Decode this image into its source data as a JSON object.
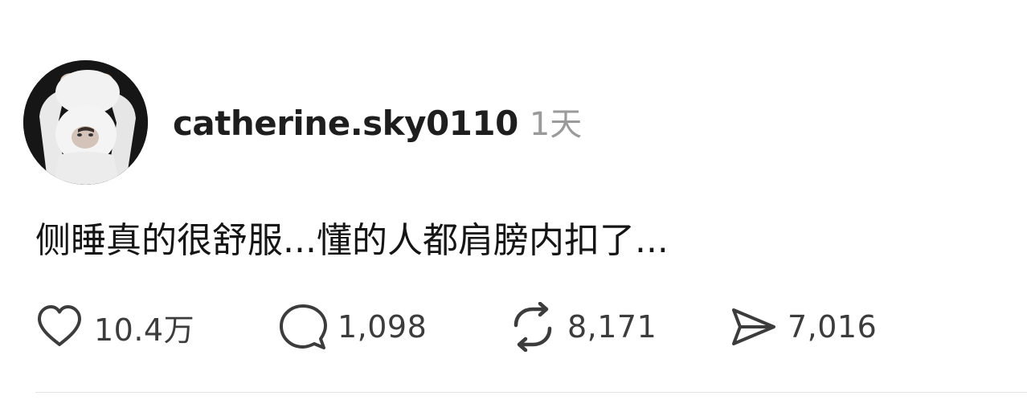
{
  "post": {
    "username": "catherine.sky0110",
    "timestamp": "1天",
    "text": "侧睡真的很舒服...懂的人都肩膀内扣了...",
    "actions": {
      "like": {
        "icon": "heart-icon",
        "count": "10.4万"
      },
      "comment": {
        "icon": "speech-bubble-icon",
        "count": "1,098"
      },
      "repost": {
        "icon": "repost-icon",
        "count": "8,171"
      },
      "share": {
        "icon": "send-icon",
        "count": "7,016"
      }
    }
  },
  "colors": {
    "text": "#1e1e1e",
    "muted": "#9a9a9a",
    "icon": "#3c3c3c",
    "divider": "#e3e3e3"
  }
}
